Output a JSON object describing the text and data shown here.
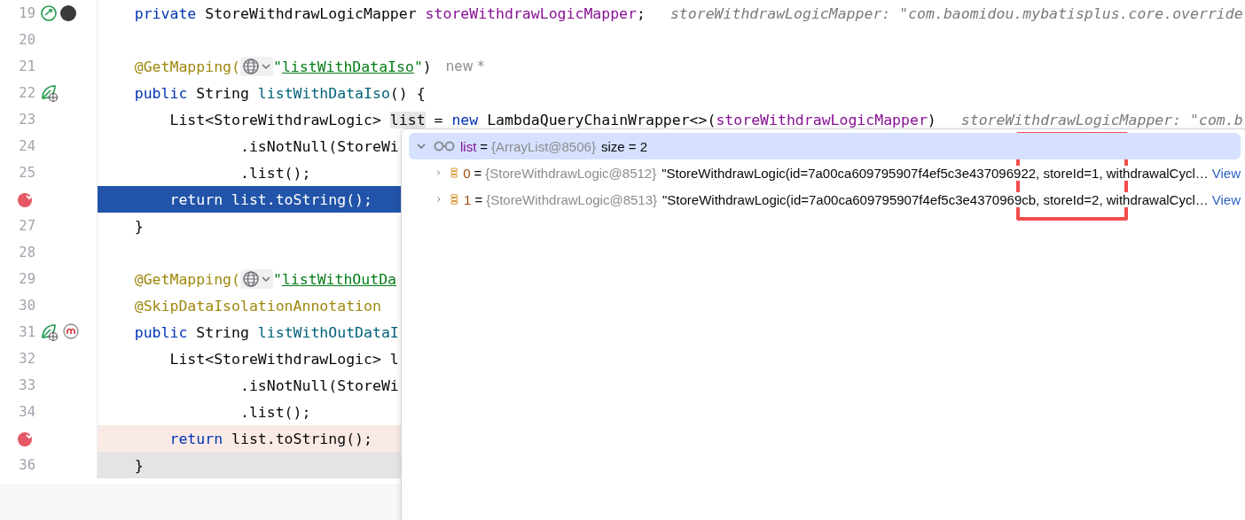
{
  "editor": {
    "lines": [
      {
        "number": "19",
        "gutter_icons": [
          {
            "kind": "bean-link"
          },
          {
            "kind": "avatar"
          }
        ],
        "tokens": [
          {
            "kind": "keyword",
            "text": "    private "
          },
          {
            "kind": "plain",
            "text": "StoreWithdrawLogicMapper "
          },
          {
            "kind": "field",
            "text": "storeWithdrawLogicMapper"
          },
          {
            "kind": "plain",
            "text": ";"
          },
          {
            "kind": "hint",
            "text": "storeWithdrawLogicMapper: \"com.baomidou.mybatisplus.core.override"
          }
        ]
      },
      {
        "number": "20"
      },
      {
        "number": "21",
        "tokens": [
          {
            "kind": "annotation",
            "text": "    @GetMapping("
          },
          {
            "kind": "widget"
          },
          {
            "kind": "quote",
            "text": "\""
          },
          {
            "kind": "url",
            "text": "listWithDataIso"
          },
          {
            "kind": "quote",
            "text": "\""
          },
          {
            "kind": "plain",
            "text": ")"
          },
          {
            "kind": "label",
            "text": "new *"
          }
        ]
      },
      {
        "number": "22",
        "gutter_icons": [
          {
            "kind": "web-endpoint"
          }
        ],
        "tokens": [
          {
            "kind": "keyword",
            "text": "    public "
          },
          {
            "kind": "plain",
            "text": "String "
          },
          {
            "kind": "method",
            "text": "listWithDataIso"
          },
          {
            "kind": "plain",
            "text": "() {"
          }
        ]
      },
      {
        "number": "23",
        "tokens": [
          {
            "kind": "plain",
            "text": "        List<StoreWithdrawLogic> "
          },
          {
            "kind": "usage",
            "text": "list"
          },
          {
            "kind": "plain",
            "text": " = "
          },
          {
            "kind": "keyword",
            "text": "new "
          },
          {
            "kind": "plain",
            "text": "LambdaQueryChainWrapper<>("
          },
          {
            "kind": "field",
            "text": "storeWithdrawLogicMapper"
          },
          {
            "kind": "plain",
            "text": ")"
          },
          {
            "kind": "hint",
            "text": "storeWithdrawLogicMapper: \"com.b"
          }
        ]
      },
      {
        "number": "24",
        "tokens": [
          {
            "kind": "plain",
            "text": "                .isNotNull(StoreWi"
          }
        ]
      },
      {
        "number": "25",
        "tokens": [
          {
            "kind": "plain",
            "text": "                .list();"
          }
        ]
      },
      {
        "breakpoint": true,
        "execution_point": true,
        "tokens": [
          {
            "kind": "keyword",
            "text": "        return "
          },
          {
            "kind": "plain",
            "text": "list.toString();"
          }
        ]
      },
      {
        "number": "27",
        "tokens": [
          {
            "kind": "plain",
            "text": "    }"
          }
        ]
      },
      {
        "number": "28"
      },
      {
        "number": "29",
        "tokens": [
          {
            "kind": "annotation",
            "text": "    @GetMapping("
          },
          {
            "kind": "widget"
          },
          {
            "kind": "quote",
            "text": "\""
          },
          {
            "kind": "url",
            "text": "listWithOutDa"
          }
        ]
      },
      {
        "number": "30",
        "tokens": [
          {
            "kind": "annotation",
            "text": "    @SkipDataIsolationAnnotation"
          }
        ]
      },
      {
        "number": "31",
        "gutter_icons": [
          {
            "kind": "web-endpoint"
          },
          {
            "kind": "mapper"
          }
        ],
        "tokens": [
          {
            "kind": "keyword",
            "text": "    public "
          },
          {
            "kind": "plain",
            "text": "String "
          },
          {
            "kind": "method",
            "text": "listWithOutDataI"
          }
        ]
      },
      {
        "number": "32",
        "tokens": [
          {
            "kind": "plain",
            "text": "        List<StoreWithdrawLogic> l"
          }
        ]
      },
      {
        "number": "33",
        "tokens": [
          {
            "kind": "plain",
            "text": "                .isNotNull(StoreWi"
          }
        ]
      },
      {
        "number": "34",
        "tokens": [
          {
            "kind": "plain",
            "text": "                .list();"
          }
        ]
      },
      {
        "breakpoint": true,
        "execution_point": false,
        "tokens": [
          {
            "kind": "keyword",
            "text": "        return "
          },
          {
            "kind": "plain",
            "text": "list.toString();"
          }
        ]
      },
      {
        "number": "36",
        "caret_line": true,
        "tokens": [
          {
            "kind": "plain",
            "text": "    }"
          }
        ]
      }
    ]
  },
  "debug_popup": {
    "rows": [
      {
        "name": "list",
        "operator": "=",
        "type": "{ArrayList@8506}",
        "value": "size = 2",
        "expanded": true,
        "selected": true
      },
      {
        "name": "0",
        "operator": "=",
        "type": "{StoreWithdrawLogic@8512}",
        "value": "\"StoreWithdrawLogic(id=7a00ca609795907f4ef5c3e437096922, storeId=1, withdrawalCycl…",
        "link": "View",
        "expanded": false,
        "selected": false
      },
      {
        "name": "1",
        "operator": "=",
        "type": "{StoreWithdrawLogic@8513}",
        "value": "\"StoreWithdrawLogic(id=7a00ca609795907f4ef5c3e4370969cb, storeId=2, withdrawalCycl…",
        "link": "View",
        "expanded": false,
        "selected": false
      }
    ]
  }
}
